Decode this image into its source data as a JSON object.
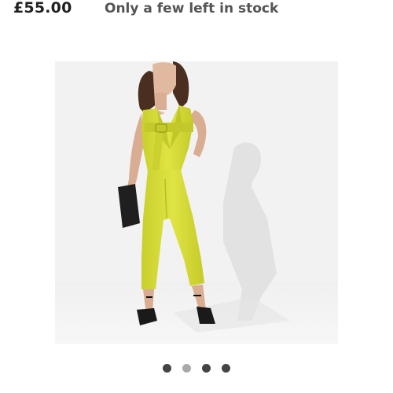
{
  "product": {
    "price": "£55.00",
    "stock_status": "Only a few left in stock",
    "image_alt": "Yellow belted sleeveless jumpsuit",
    "colors": {
      "garment": "#d8dd3a",
      "background": "#f1f1f1"
    }
  },
  "carousel": {
    "total": 4,
    "active_index": 1,
    "dots": [
      {
        "state": "inactive-dark"
      },
      {
        "state": "active"
      },
      {
        "state": "inactive-dark"
      },
      {
        "state": "inactive-dark"
      }
    ]
  }
}
